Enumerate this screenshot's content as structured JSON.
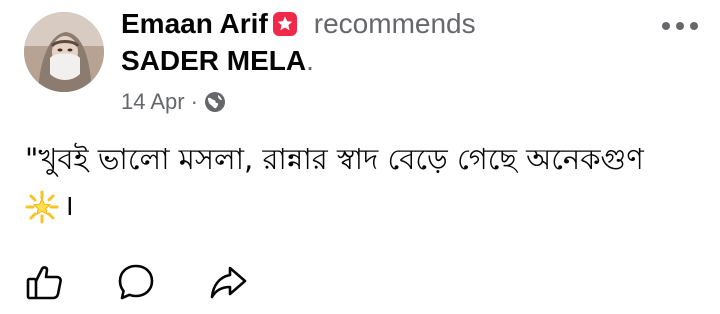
{
  "post": {
    "author": "Emaan Arif",
    "verb": "recommends",
    "page_name": "SADER MELA",
    "period": ".",
    "date": "14 Apr",
    "separator": "·",
    "privacy_icon": "globe-icon",
    "body_text": "\"খুবই ভালো মসলা, রান্নার স্বাদ বেড়ে গেছে অনেকগুণ",
    "body_end": "।",
    "emoji_icon": "glowing-star-icon"
  },
  "actions": {
    "icons": [
      "thumbs-up-icon",
      "comment-icon",
      "share-icon"
    ]
  },
  "colors": {
    "text_primary": "#050505",
    "text_secondary": "#65676b",
    "badge": "#f02849",
    "background": "#ffffff"
  }
}
